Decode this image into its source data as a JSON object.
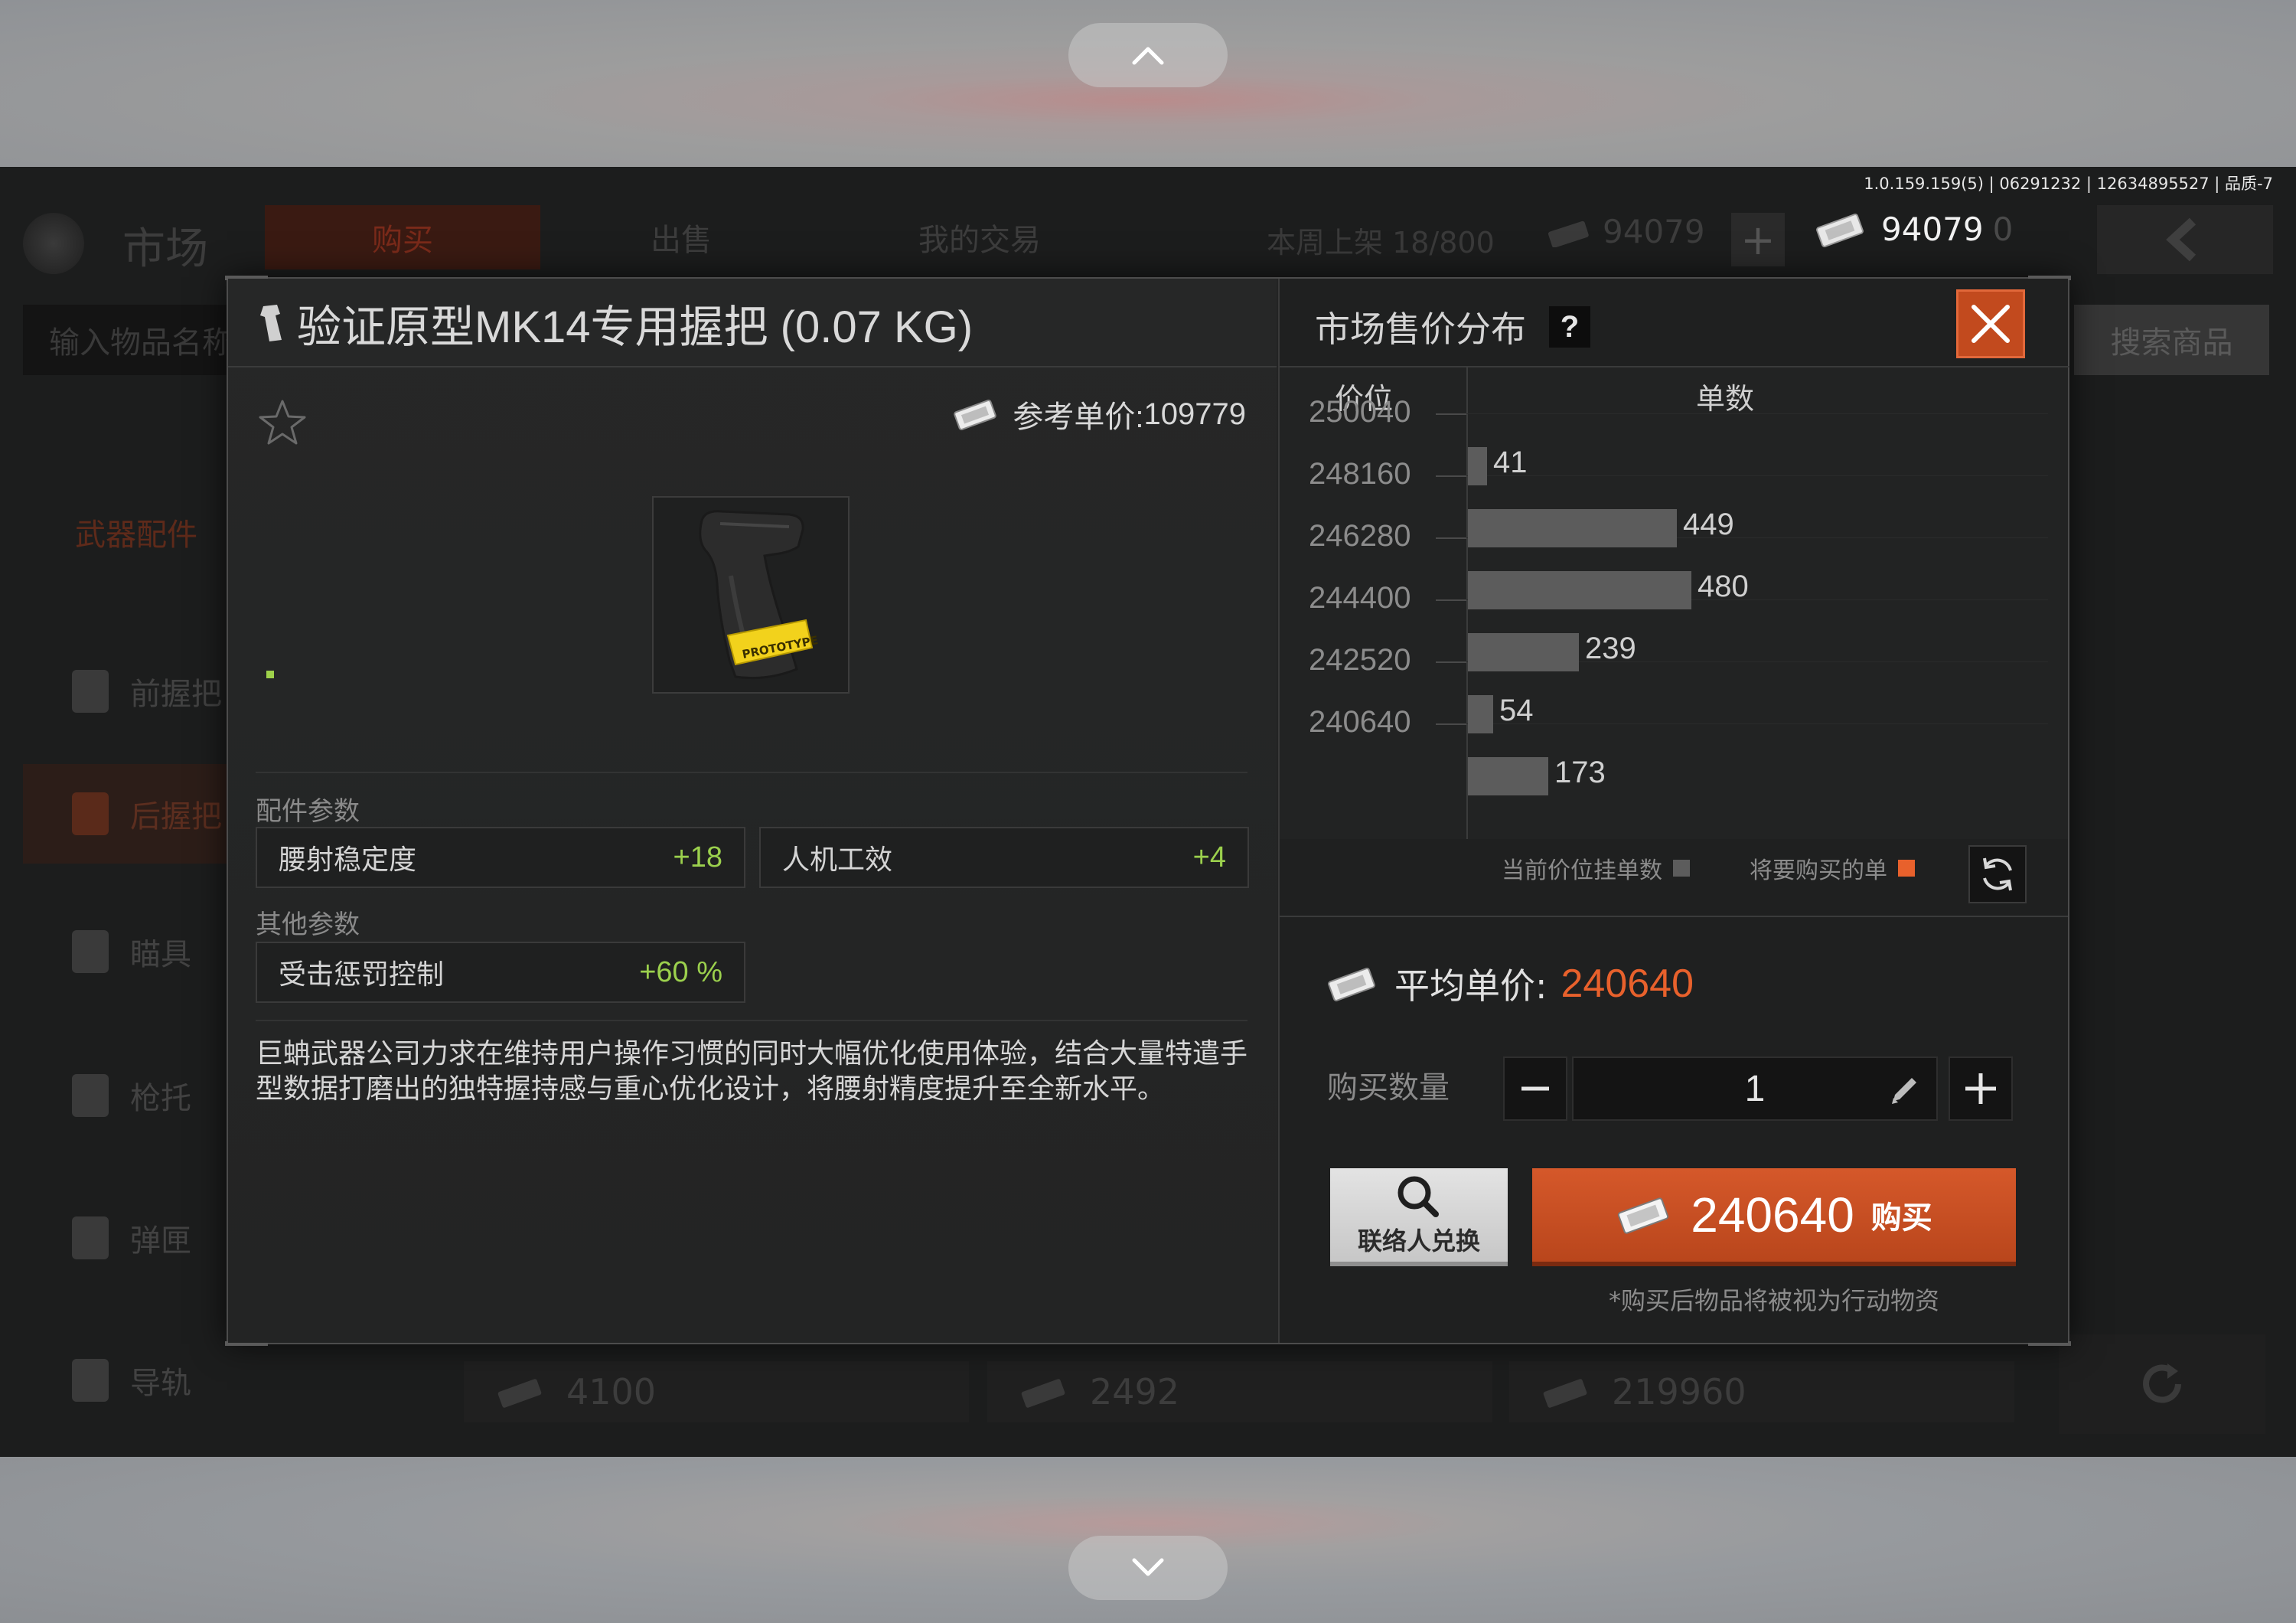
{
  "nav": {
    "up_label": "scroll up",
    "down_label": "scroll down"
  },
  "version_info": "1.0.159.159(5) | 06291232 | 12634895527 | 品质-7",
  "background": {
    "title": "市场",
    "tabs": [
      "购买",
      "出售",
      "我的交易"
    ],
    "weekly_listing": "本周上架 18/800",
    "balance_dim": "94079",
    "balance": "94079",
    "balance_tail": "0",
    "search_placeholder": "输入物品名称",
    "search_button": "搜索商品",
    "category": "武器配件",
    "sidebar": [
      "前握把",
      "后握把",
      "瞄具",
      "枪托",
      "弹匣",
      "导轨"
    ],
    "bottom_prices": [
      "4100",
      "2492",
      "219960"
    ]
  },
  "item": {
    "title": "验证原型MK14专用握把 (0.07 KG)",
    "ref_price_label": "参考单价:",
    "ref_price": "109779",
    "badge_text": "PROTOTYPE"
  },
  "params": {
    "section1": "配件参数",
    "section2": "其他参数",
    "rows": [
      {
        "label": "腰射稳定度",
        "value": "+18"
      },
      {
        "label": "人机工效",
        "value": "+4"
      },
      {
        "label": "受击惩罚控制",
        "value": "+60 %"
      }
    ]
  },
  "description": "巨蚺武器公司力求在维持用户操作习惯的同时大幅优化使用体验，结合大量特遣手型数据打磨出的独特握持感与重心优化设计，将腰射精度提升至全新水平。",
  "market": {
    "title": "市场售价分布",
    "help": "?",
    "col_price": "价位",
    "col_count": "单数",
    "price_ticks": [
      "250040",
      "248160",
      "246280",
      "244400",
      "242520",
      "240640"
    ],
    "legend_current": "当前价位挂单数",
    "legend_buy": "将要购买的单"
  },
  "chart_data": {
    "type": "bar",
    "orientation": "horizontal",
    "categories": [
      "250040",
      "248160",
      "246280",
      "244400",
      "242520",
      "240640"
    ],
    "values": [
      41,
      449,
      480,
      239,
      54,
      173
    ],
    "xlabel": "单数",
    "ylabel": "价位",
    "xlim": [
      0,
      1250
    ]
  },
  "purchase": {
    "avg_label": "平均单价:",
    "avg_value": "240640",
    "qty_label": "购买数量",
    "qty_value": "1",
    "contact_label": "联络人兑换",
    "buy_amount": "240640",
    "buy_label": "购买",
    "note": "*购买后物品将被视为行动物资"
  },
  "colors": {
    "accent": "#e8612c",
    "positive": "#9bd04d",
    "bar": "#5c5c5c"
  }
}
